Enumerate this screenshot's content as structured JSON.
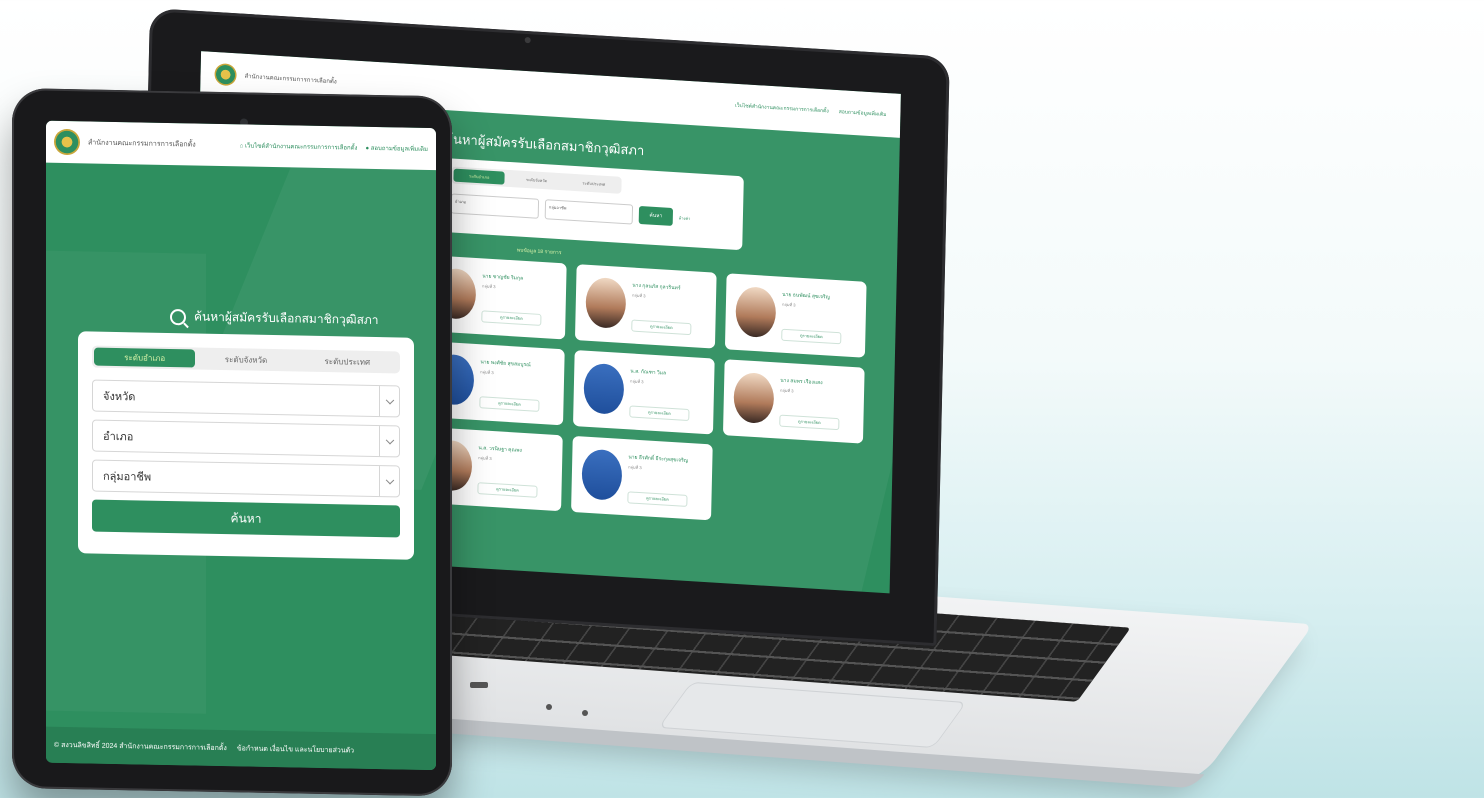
{
  "laptop": {
    "brand": "สำนักงานคณะกรรมการการเลือกตั้ง",
    "nav_links": [
      "เว็บไซต์สำนักงานคณะกรรมการการเลือกตั้ง",
      "สอบถามข้อมูลเพิ่มเติม"
    ],
    "title": "ค้นหาผู้สมัครรับเลือกสมาชิกวุฒิสภา",
    "tabs": [
      "ระดับอำเภอ",
      "ระดับจังหวัด",
      "ระดับประเทศ"
    ],
    "fields": [
      "อำเภอ",
      "กลุ่มอาชีพ"
    ],
    "search_label": "ค้นหา",
    "reset_label": "ล้างค่า",
    "result_count": "พบข้อมูล 18 รายการ",
    "cards": [
      {
        "name": "นาย ชาญชัย ริมกุล",
        "group": "กลุ่มที่ 3",
        "button": "ดูรายละเอียด"
      },
      {
        "name": "นาง กุลนภัส กุลวรินทร์",
        "group": "กลุ่มที่ 3",
        "button": "ดูรายละเอียด"
      },
      {
        "name": "นาย ธนพัฒน์ สุขเจริญ",
        "group": "กลุ่มที่ 3",
        "button": "ดูรายละเอียด"
      },
      {
        "name": "นาย พงศ์ชัย สุขสมบูรณ์",
        "group": "กลุ่มที่ 3",
        "button": "ดูรายละเอียด"
      },
      {
        "name": "น.ส. กัณฑา วิมล",
        "group": "กลุ่มที่ 3",
        "button": "ดูรายละเอียด"
      },
      {
        "name": "นาง สมพร เรืองแสง",
        "group": "กลุ่มที่ 3",
        "button": "ดูรายละเอียด"
      },
      {
        "name": "น.ส. วรนิษฐา คุณพง",
        "group": "กลุ่มที่ 3",
        "button": "ดูรายละเอียด"
      },
      {
        "name": "นาย ธีรศักดิ์ ธีระกุลสุขเจริญ",
        "group": "กลุ่มที่ 3",
        "button": "ดูรายละเอียด"
      }
    ]
  },
  "tablet": {
    "brand": "สำนักงานคณะกรรมการการเลือกตั้ง",
    "nav_links": [
      "เว็บไซต์สำนักงานคณะกรรมการการเลือกตั้ง",
      "สอบถามข้อมูลเพิ่มเติม"
    ],
    "title": "ค้นหาผู้สมัครรับเลือกสมาชิกวุฒิสภา",
    "tabs": [
      "ระดับอำเภอ",
      "ระดับจังหวัด",
      "ระดับประเทศ"
    ],
    "selects": [
      "จังหวัด",
      "อำเภอ",
      "กลุ่มอาชีพ"
    ],
    "submit_label": "ค้นหา",
    "footer_copyright": "© สงวนลิขสิทธิ์ 2024 สำนักงานคณะกรรมการการเลือกตั้ง",
    "footer_link": "ข้อกำหนด เงื่อนไข และนโยบายส่วนตัว"
  },
  "colors": {
    "brand_green": "#2e8f5f",
    "tab_active_text": "#d9f3a9"
  }
}
